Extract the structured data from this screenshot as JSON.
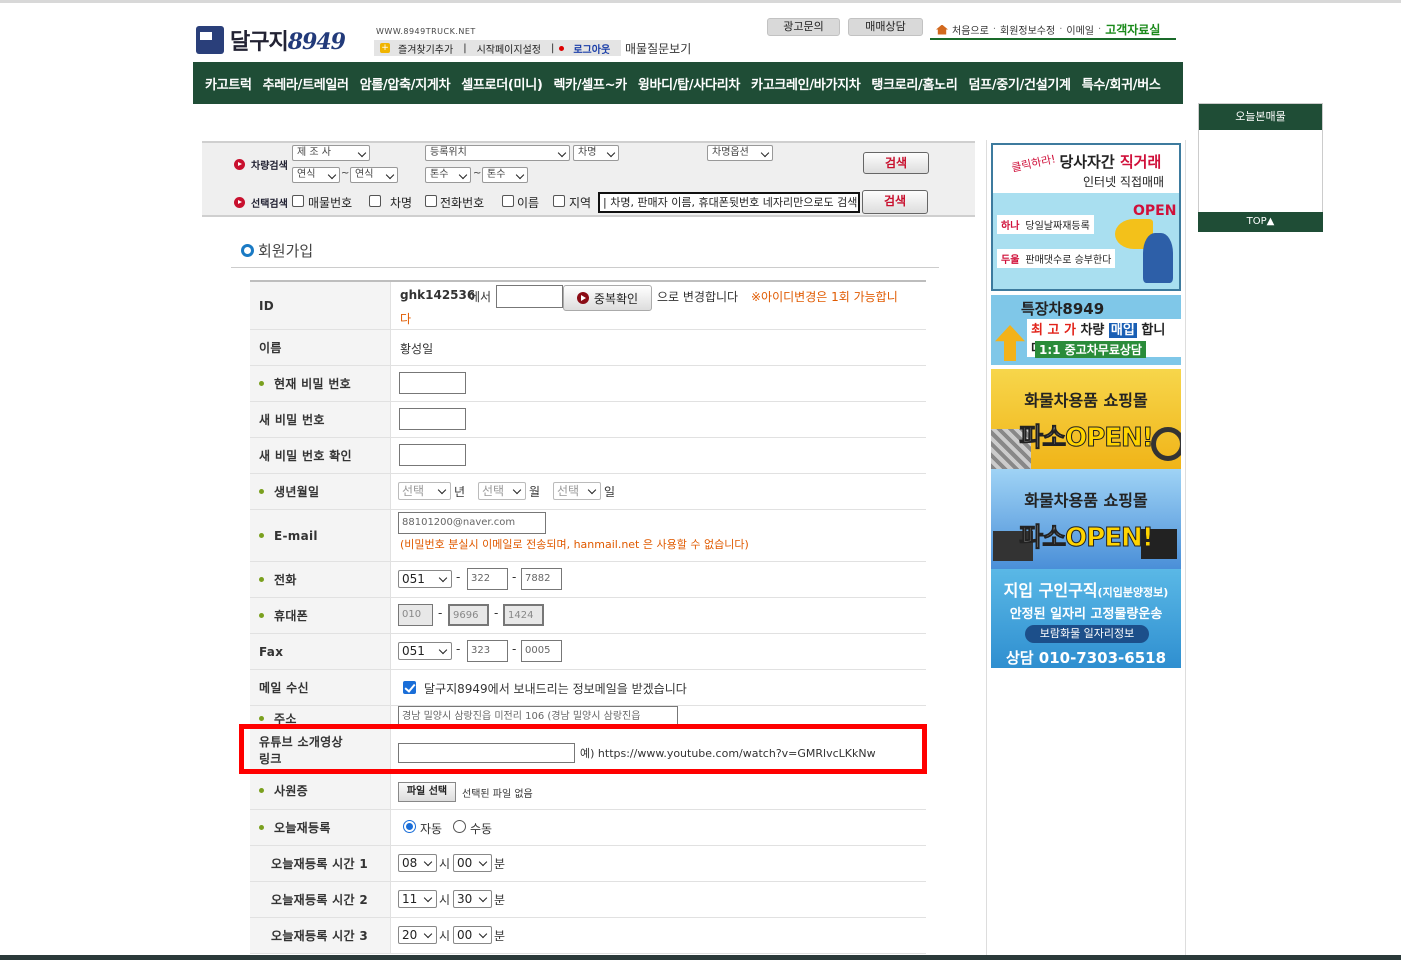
{
  "header": {
    "logo_text": "달구지",
    "logo_num": "8949",
    "url": "WWW.8949TRUCK.NET",
    "sub": {
      "bookmark": "즐겨찾기추가",
      "homepage": "시작페이지설정",
      "logout": "로그아웃"
    },
    "faq": "매물질문보기",
    "ad_inquiry": "광고문의",
    "trade_consult": "매매상담",
    "links": {
      "home": "처음으로",
      "member_edit": "회원정보수정",
      "email": "이메일",
      "data_room": "고객자료실"
    }
  },
  "nav": [
    "카고트럭",
    "추레라/트레일러",
    "암롤/압축/지게차",
    "셀프로더(미니)",
    "렉카/셀프~카",
    "윙바디/탑/사다리차",
    "카고크레인/바가지차",
    "탱크로리/홈노리",
    "덤프/중기/건설기계",
    "특수/회귀/버스"
  ],
  "today": {
    "title": "오늘본매물",
    "top": "TOP▲"
  },
  "search": {
    "vehicle_label": "차량검색",
    "select_label": "선택검색",
    "maker": "제 조 사",
    "location": "등록위치",
    "model": "차명",
    "option": "차명옵션",
    "year_from": "연식",
    "year_to": "연식",
    "ton_from": "톤수",
    "ton_to": "톤수",
    "btn": "검색",
    "checks": [
      "매물번호",
      "차명",
      "전화번호",
      "이름",
      "지역"
    ],
    "keyword": "| 차명, 판매자 이름, 휴대폰뒷번호 네자리만으로도 검색가"
  },
  "page_title": "회원가입",
  "form": {
    "id": {
      "label": "ID",
      "value": "ghk142536",
      "from": "에서",
      "dup_btn": "중복확인",
      "suffix": "으로 변경합니다",
      "note1": "※아이디변경은 1회 가능합니",
      "note2": "다"
    },
    "name": {
      "label": "이름",
      "value": "황성일"
    },
    "cur_pw": {
      "label": "현재 비밀 번호"
    },
    "new_pw": {
      "label": "새 비밀 번호"
    },
    "new_pw2": {
      "label": "새 비밀 번호 확인"
    },
    "birth": {
      "label": "생년월일",
      "sel": "선택",
      "y": "년",
      "m": "월",
      "d": "일"
    },
    "email": {
      "label": "E-mail",
      "value": "88101200@naver.com",
      "note": "(비밀번호 분실시 이메일로 전송되며, hanmail.net 은 사용할 수 없습니다)"
    },
    "phone": {
      "label": "전화",
      "p1": "051",
      "p2": "322",
      "p3": "7882"
    },
    "mobile": {
      "label": "휴대폰",
      "p1": "010",
      "p2": "9696",
      "p3": "1424"
    },
    "fax": {
      "label": "Fax",
      "p1": "051",
      "p2": "323",
      "p3": "0005"
    },
    "mail_recv": {
      "label": "메일 수신",
      "text": "달구지8949에서 보내드리는 정보메일을 받겠습니다"
    },
    "address": {
      "label": "주소",
      "value": "경남 밀양시 삼랑진읍 미전리 106 (경남 밀양시 삼랑진읍"
    },
    "youtube": {
      "label1": "유튜브 소개영상",
      "label2": "링크",
      "example": "예) https://www.youtube.com/watch?v=GMRlvcLKkNw"
    },
    "employee_card": {
      "label": "사원증",
      "btn": "파일 선택",
      "status": "선택된 파일 없음"
    },
    "today_reg": {
      "label": "오늘재등록",
      "auto": "자동",
      "manual": "수동"
    },
    "time1": {
      "label": "오늘재등록 시간 1",
      "h": "08",
      "m": "00"
    },
    "time2": {
      "label": "오늘재등록 시간 2",
      "h": "11",
      "m": "30"
    },
    "time3": {
      "label": "오늘재등록 시간 3",
      "h": "20",
      "m": "00"
    },
    "hour_unit": "시",
    "min_unit": "분"
  },
  "ads": {
    "a1": {
      "tag": "클릭하라!",
      "title_a": "당사자간",
      "title_b": "직거래",
      "sub": "인터넷 직접매매",
      "row1_n": "하나",
      "row1": "당일날짜재등록",
      "row2_n": "두울",
      "row2": "판매댓수로 승부한다",
      "open": "OPEN"
    },
    "a2": {
      "title": "특장차8949",
      "s_a": "최 고 가",
      "s_b": "차량",
      "s_c": "매입",
      "s_d": "합니다",
      "u": "1:1 중고차무료상담"
    },
    "a3": {
      "title": "화물차용품 쇼핑몰",
      "open_a": "파소",
      "open_b": "OPEN!"
    },
    "a4": {
      "title": "화물차용품 쇼핑몰",
      "open_a": "파소",
      "open_b": "OPEN!"
    },
    "a5": {
      "title": "지입 구인구직",
      "title_small": "(지입분양정보)",
      "sub": "안정된 일자리 고정물량운송",
      "badge": "보람화물 일자리정보",
      "phone": "상담 010-7303-6518"
    }
  }
}
